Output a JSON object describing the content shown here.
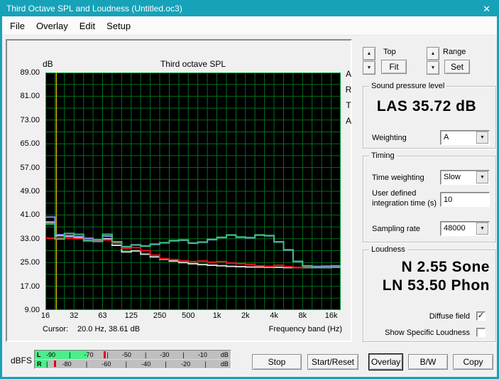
{
  "window": {
    "title": "Third Octave SPL and Loudness (Untitled.oc3)",
    "close_glyph": "✕"
  },
  "menu": {
    "items": [
      "File",
      "Overlay",
      "Edit",
      "Setup"
    ]
  },
  "graph": {
    "unit_label": "dB",
    "title": "Third octave SPL",
    "watermark": "ARTA",
    "cursor_label": "Cursor:",
    "cursor_value": "20.0 Hz, 38.61 dB",
    "xlabel": "Frequency band (Hz)"
  },
  "chart_data": {
    "type": "line",
    "subtype": "third-octave-step",
    "title": "Third octave SPL",
    "ylabel": "dB",
    "xlabel": "Frequency band (Hz)",
    "ylim": [
      9,
      89
    ],
    "yticks": [
      "89.00",
      "81.00",
      "73.00",
      "65.00",
      "57.00",
      "49.00",
      "41.00",
      "33.00",
      "25.00",
      "17.00",
      "9.00"
    ],
    "xticks": [
      "16",
      "32",
      "63",
      "125",
      "250",
      "500",
      "1k",
      "2k",
      "4k",
      "8k",
      "16k"
    ],
    "xtick_band_step": 3,
    "bands": [
      "16",
      "20",
      "25",
      "31.5",
      "40",
      "50",
      "63",
      "80",
      "100",
      "125",
      "160",
      "200",
      "250",
      "315",
      "400",
      "500",
      "630",
      "800",
      "1k",
      "1.25k",
      "1.6k",
      "2k",
      "2.5k",
      "3.15k",
      "4k",
      "5k",
      "6.3k",
      "8k",
      "10k",
      "12.5k",
      "16k"
    ],
    "grid": true,
    "plot_bg": "#000000",
    "grid_color": "#00701e",
    "border_color": "#00a43c",
    "cursor_color": "#c7b500",
    "cursor": {
      "band_index": 1.15,
      "freq_hz": 20.0,
      "level_db": 38.61
    },
    "series": [
      {
        "name": "spl-white",
        "color": "#d6d6d6",
        "values": [
          38.6,
          34.1,
          33.8,
          33.4,
          32.8,
          32.2,
          33.0,
          30.8,
          28.6,
          28.9,
          27.8,
          26.9,
          26.1,
          25.5,
          25.0,
          24.6,
          24.3,
          24.1,
          23.9,
          23.7,
          23.6,
          23.5,
          23.5,
          23.4,
          23.4,
          23.3,
          23.3,
          23.3,
          23.3,
          23.3,
          23.4
        ]
      },
      {
        "name": "spl-red",
        "color": "#ee1414",
        "values": [
          33.2,
          33.3,
          33.1,
          33.0,
          32.9,
          32.4,
          32.6,
          31.5,
          29.8,
          30.0,
          29.0,
          27.5,
          26.3,
          26.0,
          25.6,
          25.3,
          25.5,
          25.1,
          25.3,
          24.8,
          24.6,
          24.4,
          23.9,
          23.7,
          24.1,
          23.6,
          23.3,
          23.5,
          23.6,
          23.4,
          23.5
        ]
      },
      {
        "name": "spl-blue",
        "color": "#8585ea",
        "values": [
          40.3,
          34.4,
          34.1,
          33.8,
          33.2,
          32.7,
          33.9,
          32.0,
          30.4,
          31.0,
          30.6,
          31.1,
          31.6,
          32.3,
          32.5,
          31.5,
          31.8,
          32.7,
          33.4,
          34.2,
          33.5,
          33.3,
          34.2,
          34.0,
          31.9,
          29.2,
          25.3,
          23.9,
          23.7,
          23.8,
          23.9
        ]
      },
      {
        "name": "spl-green",
        "color": "#38bd80",
        "values": [
          38.0,
          32.9,
          34.8,
          34.5,
          32.3,
          32.1,
          34.5,
          31.9,
          30.3,
          30.9,
          30.5,
          31.2,
          31.7,
          32.4,
          32.6,
          31.6,
          31.9,
          32.8,
          33.5,
          34.3,
          33.6,
          33.4,
          34.3,
          34.1,
          32.0,
          29.3,
          25.4,
          23.8,
          23.4,
          23.3,
          23.4
        ]
      }
    ]
  },
  "controls": {
    "top": {
      "label": "Top",
      "fit": "Fit",
      "up_glyph": "▲",
      "down_glyph": "▼"
    },
    "range": {
      "label": "Range",
      "set": "Set"
    },
    "spl": {
      "group": "Sound pressure level",
      "value": "LAS 35.72 dB",
      "weighting_label": "Weighting",
      "weighting_value": "A"
    },
    "timing": {
      "group": "Timing",
      "time_weighting_label": "Time weighting",
      "time_weighting_value": "Slow",
      "integration_label_1": "User defined",
      "integration_label_2": "integration time (s)",
      "integration_value": "10",
      "sampling_label": "Sampling rate",
      "sampling_value": "48000"
    },
    "loudness": {
      "group": "Loudness",
      "sone": "N 2.55 Sone",
      "phon": "LN 53.50 Phon",
      "diffuse_label": "Diffuse field",
      "diffuse_checked": "true",
      "specific_label": "Show Specific Loudness",
      "specific_checked": "false"
    }
  },
  "meter": {
    "label": "dBFS",
    "rows": [
      {
        "channel": "L",
        "ticks": [
          "-90",
          "|",
          "-70",
          "|",
          "-50",
          "|",
          "-30",
          "|",
          "-10",
          "dB"
        ],
        "bar_pct": 27,
        "peak_pct": 35
      },
      {
        "channel": "R",
        "ticks": [
          "|",
          "-80",
          "|",
          "-60",
          "|",
          "-40",
          "|",
          "-20",
          "|",
          "dB"
        ],
        "bar_pct": 7,
        "peak_pct": 9.7
      }
    ]
  },
  "buttons": {
    "stop": "Stop",
    "start_reset": "Start/Reset",
    "overlay": "Overlay",
    "bw": "B/W",
    "copy": "Copy"
  }
}
